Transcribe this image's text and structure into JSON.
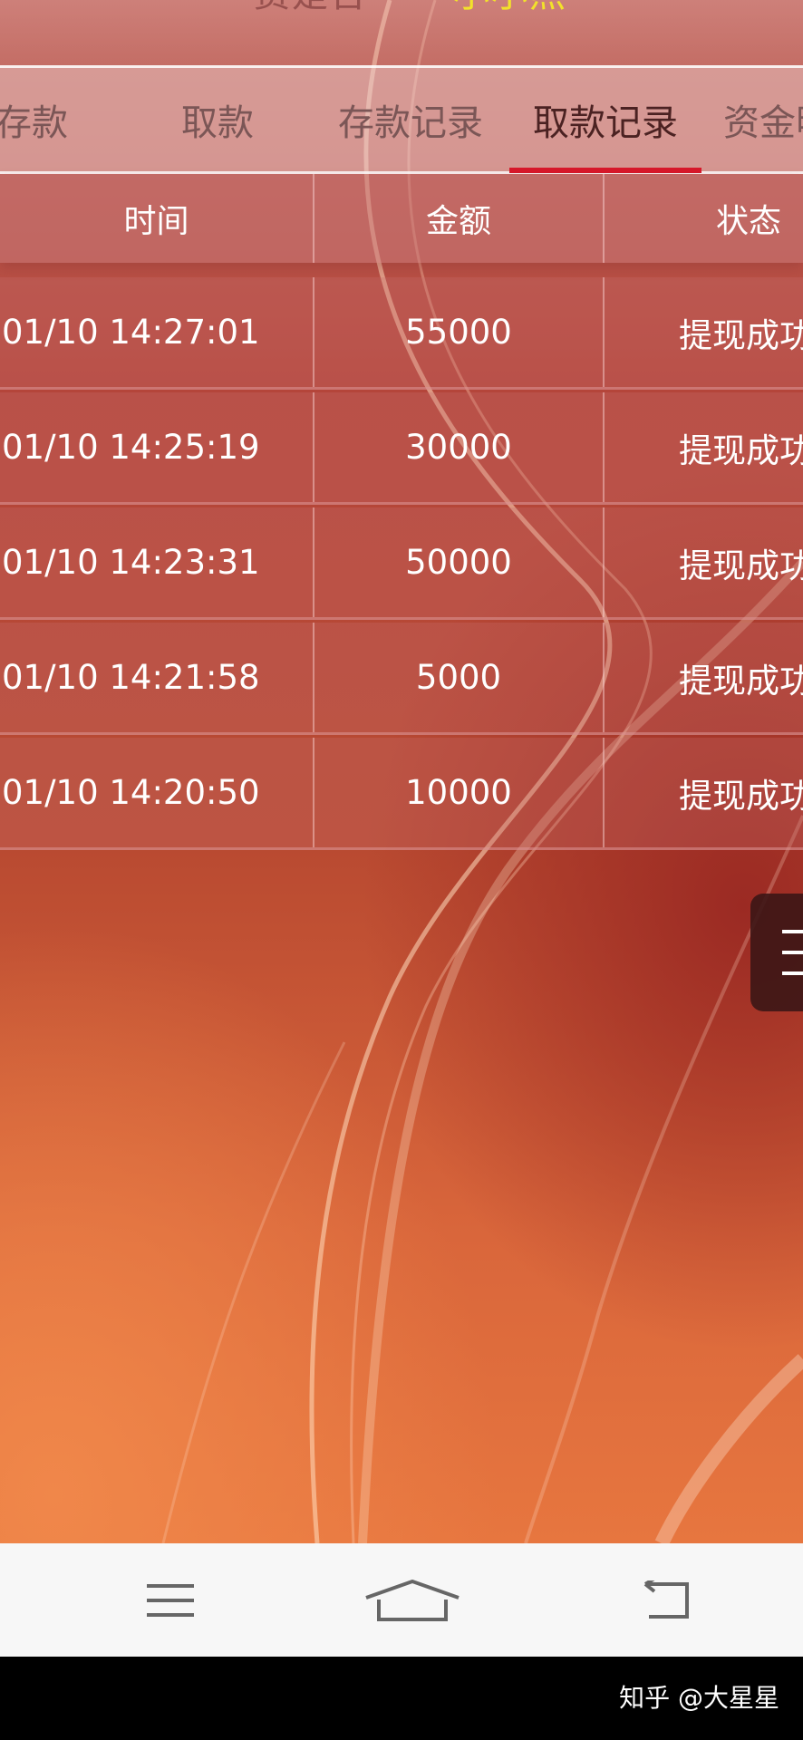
{
  "header": {
    "fragment_left": "费是否",
    "fragment_right": "小小照"
  },
  "tabs": [
    {
      "label": "存款",
      "active": false
    },
    {
      "label": "取款",
      "active": false
    },
    {
      "label": "存款记录",
      "active": false
    },
    {
      "label": "取款记录",
      "active": true
    },
    {
      "label": "资金明",
      "active": false
    }
  ],
  "table": {
    "columns": [
      "时间",
      "金额",
      "状态"
    ],
    "rows": [
      {
        "time": "01/10 14:27:01",
        "amount": "55000",
        "status": "提现成功"
      },
      {
        "time": "01/10 14:25:19",
        "amount": "30000",
        "status": "提现成功"
      },
      {
        "time": "01/10 14:23:31",
        "amount": "50000",
        "status": "提现成功"
      },
      {
        "time": "01/10 14:21:58",
        "amount": "5000",
        "status": "提现成功"
      },
      {
        "time": "01/10 14:20:50",
        "amount": "10000",
        "status": "提现成功"
      }
    ]
  },
  "floating_button": {
    "icon": "menu-icon"
  },
  "navbar": {
    "buttons": [
      {
        "icon": "menu-icon"
      },
      {
        "icon": "home-icon"
      },
      {
        "icon": "back-icon"
      }
    ]
  },
  "watermark": "知乎 @大星星",
  "colors": {
    "tab_active_underline": "#d8182a",
    "header_highlight": "#f2e22a",
    "navbar_bg": "#f7f7f7"
  }
}
